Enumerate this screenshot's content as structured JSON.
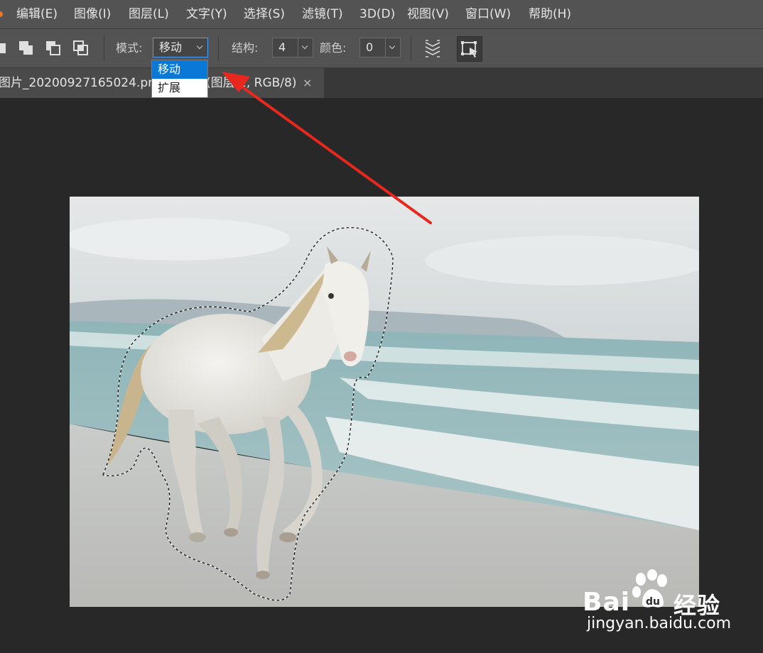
{
  "menu": {
    "items": [
      "编辑(E)",
      "图像(I)",
      "图层(L)",
      "文字(Y)",
      "选择(S)",
      "滤镜(T)",
      "3D(D)",
      "视图(V)",
      "窗口(W)",
      "帮助(H)"
    ]
  },
  "options": {
    "mode_label": "模式:",
    "mode_value": "移动",
    "structure_label": "结构:",
    "structure_value": "4",
    "color_label": "颜色:",
    "color_value": "0"
  },
  "mode_dropdown": {
    "options": [
      "移动",
      "扩展"
    ],
    "selected": "移动"
  },
  "document_tab": {
    "title": "图片_20200927165024.png",
    "title_suffix": "(图层 1, RGB/8)",
    "close_symbol": "×"
  },
  "watermark": {
    "brand": "Bai",
    "brand_cn": "经验",
    "url": "jingyan.baidu.com"
  },
  "colors": {
    "menu_bg": "#535353",
    "workspace_bg": "#282828",
    "dropdown_selected": "#0a78d7",
    "annotation_arrow": "#e8281e"
  },
  "icons": [
    "combine-shapes-icon",
    "subtract-shape-icon",
    "intersect-shape-icon",
    "exclude-shape-icon",
    "sample-all-layers-icon",
    "transform-on-drop-icon"
  ]
}
